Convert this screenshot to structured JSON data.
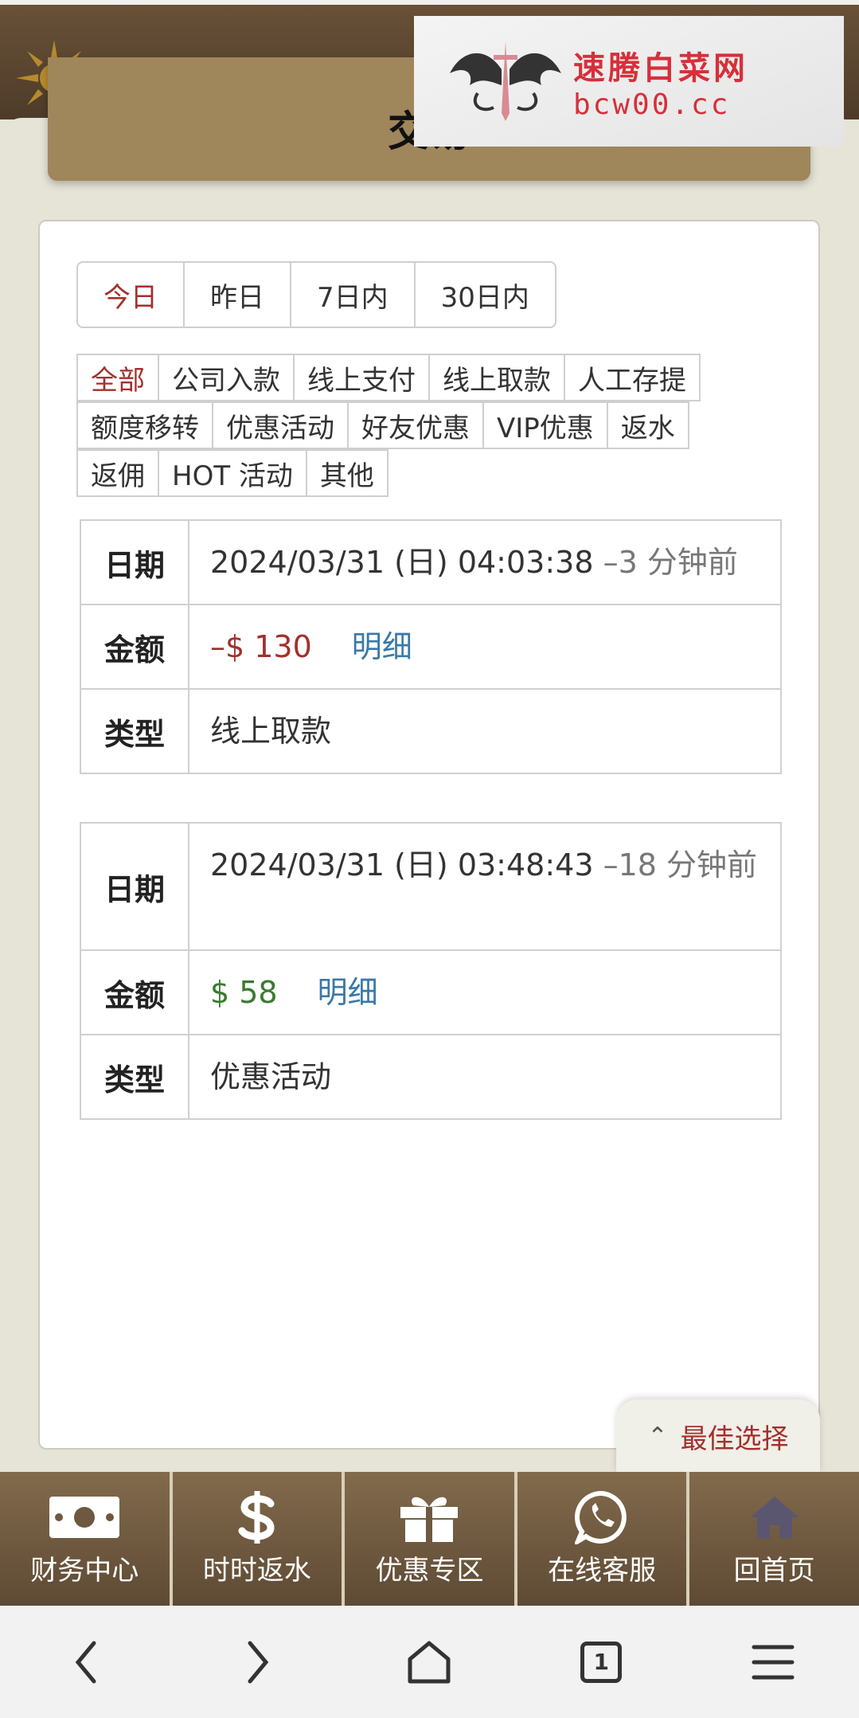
{
  "header": {
    "title": "交易"
  },
  "watermark": {
    "line1": "速腾白菜网",
    "line2": "bcw00.cc"
  },
  "date_range": [
    {
      "label": "今日",
      "active": true
    },
    {
      "label": "昨日",
      "active": false
    },
    {
      "label": "7日内",
      "active": false
    },
    {
      "label": "30日内",
      "active": false
    }
  ],
  "filters": {
    "row1": [
      "全部",
      "公司入款",
      "线上支付",
      "线上取款",
      "人工存提"
    ],
    "row2": [
      "额度移转",
      "优惠活动",
      "好友优惠",
      "VIP优惠",
      "返水"
    ],
    "row3": [
      "返佣",
      "HOT 活动",
      "其他"
    ],
    "active": "全部"
  },
  "labels": {
    "date": "日期",
    "amount": "金额",
    "type": "类型",
    "detail": "明细"
  },
  "records": [
    {
      "date": "2024/03/31 (日) 04:03:38",
      "ago": "–3 分钟前",
      "amount": "–$ 130",
      "type": "线上取款"
    },
    {
      "date": "2024/03/31 (日) 03:48:43",
      "ago": "–18 分钟前",
      "amount": "$ 58",
      "type": "优惠活动"
    }
  ],
  "best_choice": {
    "label": "最佳选择"
  },
  "bottom_nav": [
    {
      "label": "财务中心",
      "icon": "money-icon"
    },
    {
      "label": "时时返水",
      "icon": "dollar-icon"
    },
    {
      "label": "优惠专区",
      "icon": "gift-icon"
    },
    {
      "label": "在线客服",
      "icon": "whatsapp-icon"
    },
    {
      "label": "回首页",
      "icon": "home-icon"
    }
  ],
  "browser": {
    "tab_count": "1"
  },
  "colors": {
    "accent_red": "#a3302c",
    "positive_green": "#3a7a30",
    "link_blue": "#3a78a8",
    "title_bar": "#a0865b",
    "nav_brown": "#6e5840"
  }
}
